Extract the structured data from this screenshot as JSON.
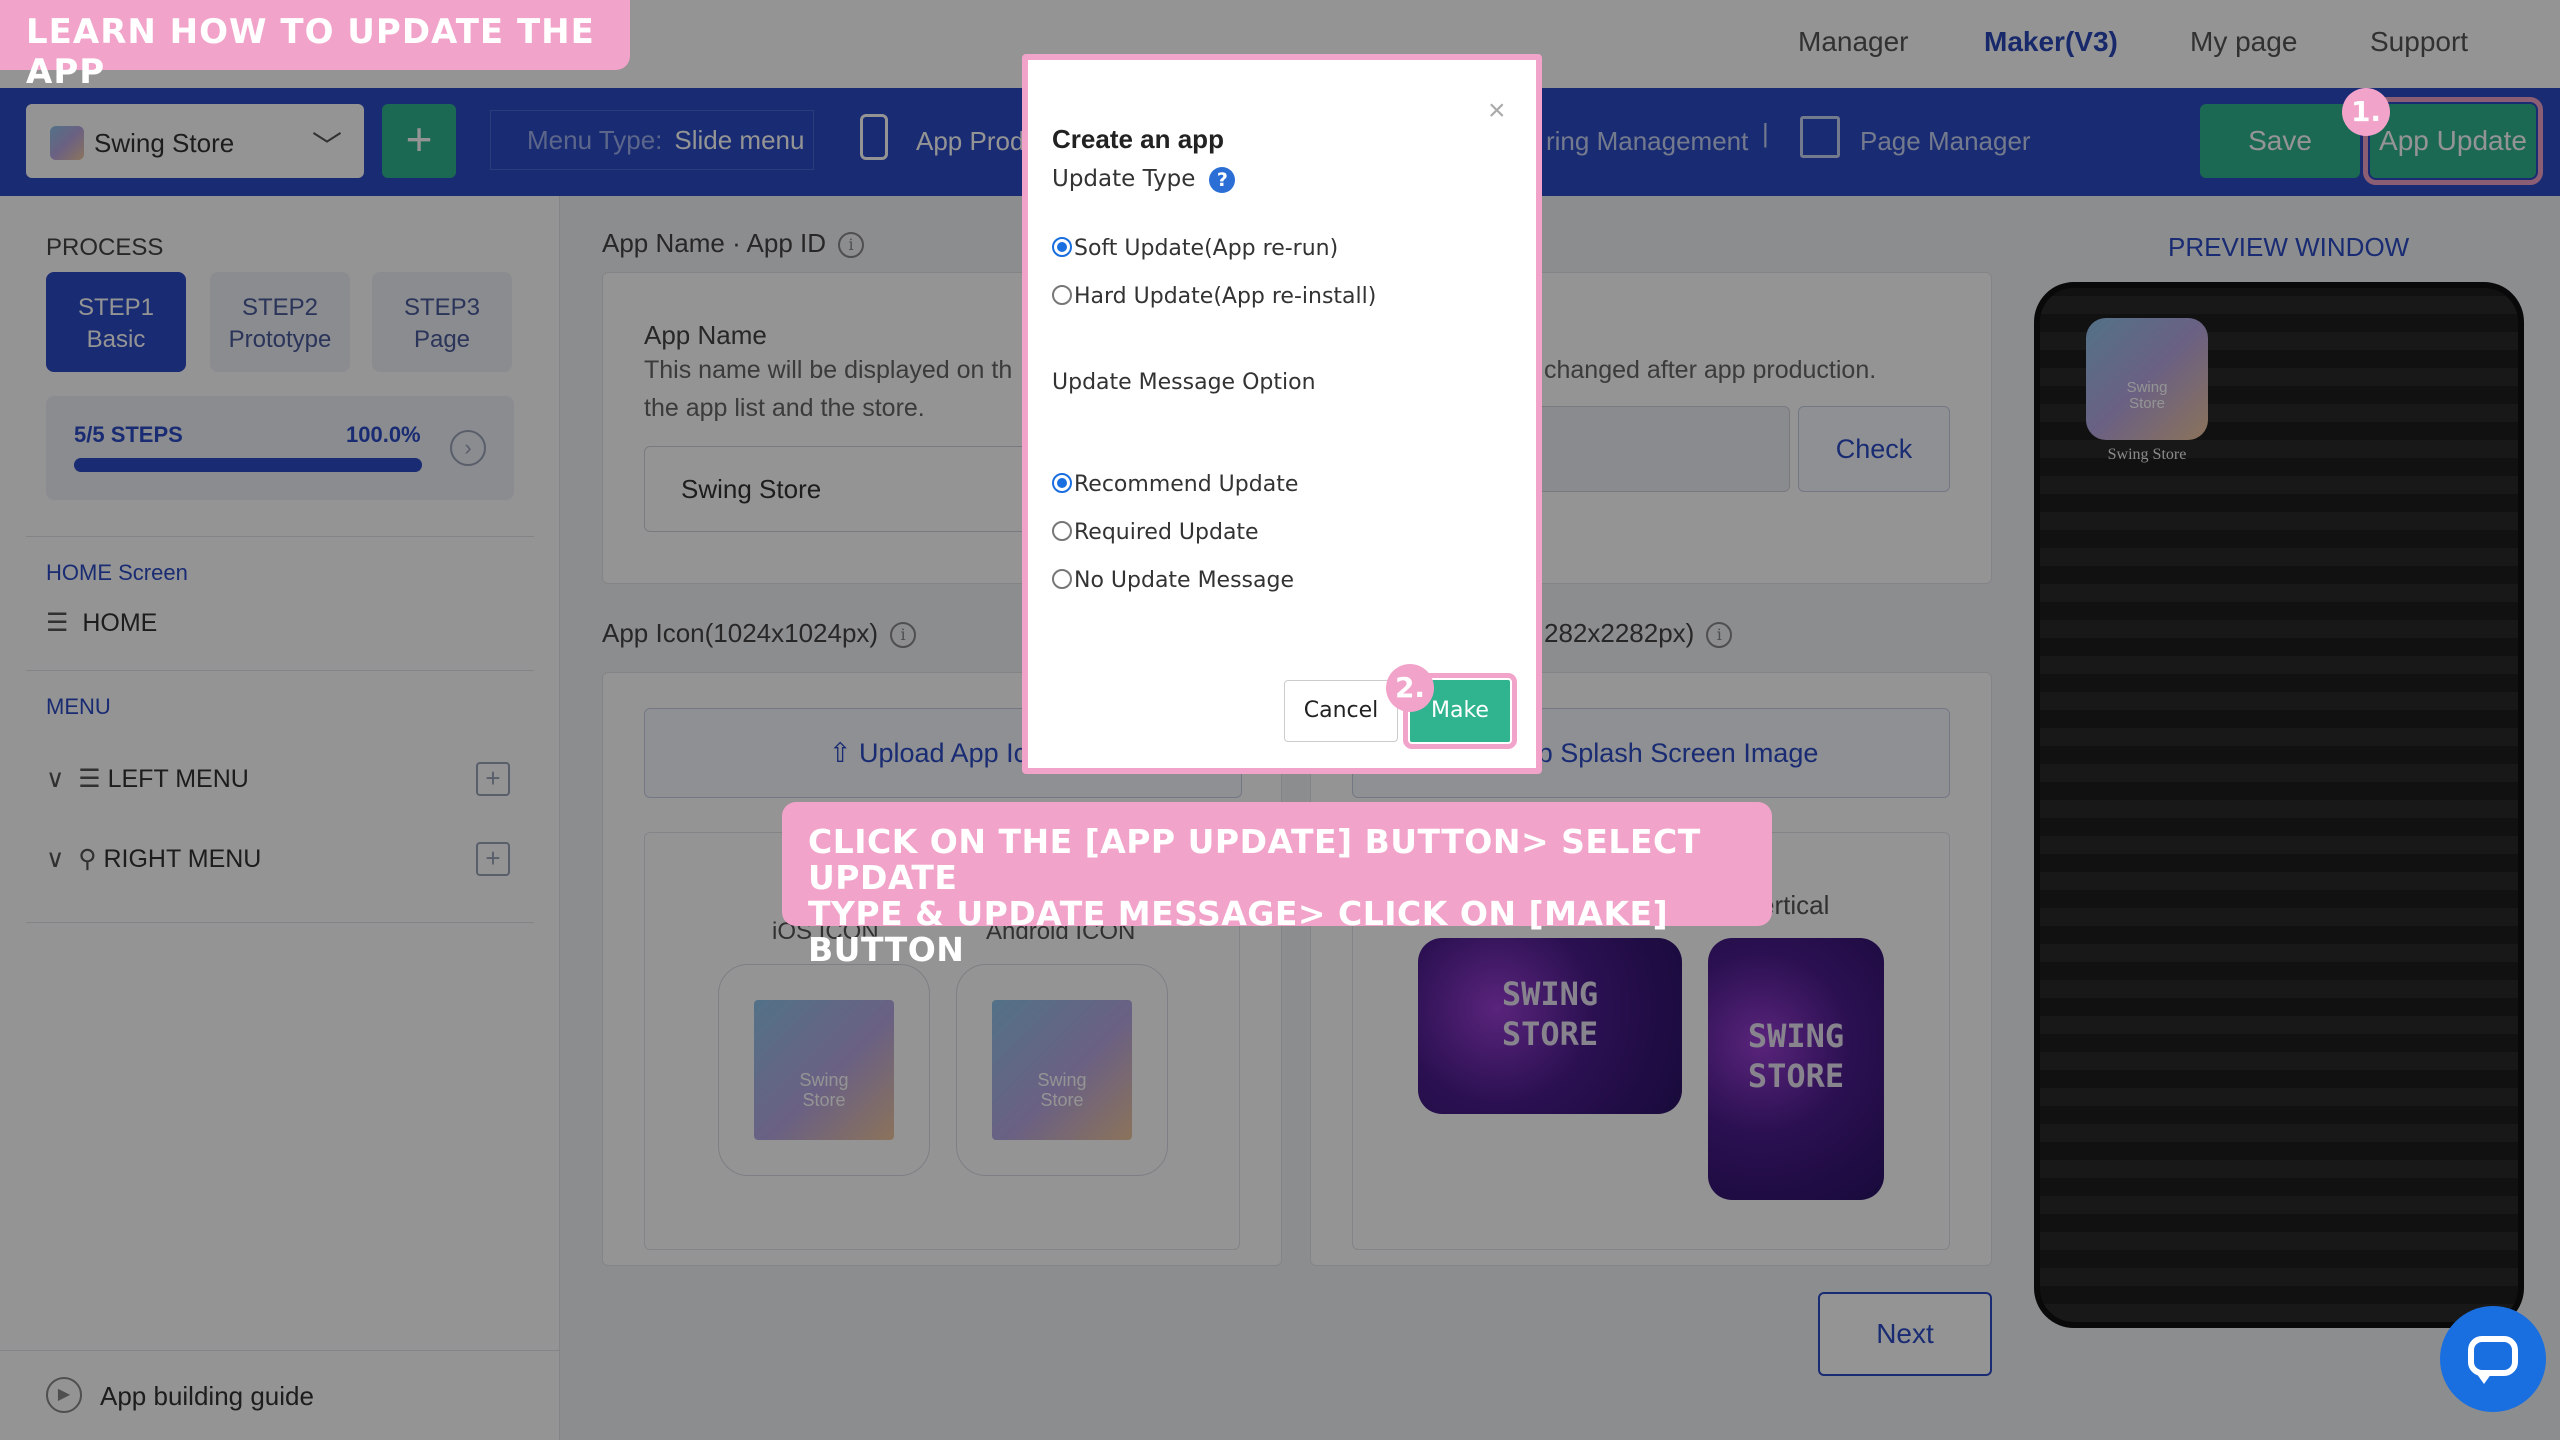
{
  "banner": {
    "text": "LEARN HOW TO UPDATE THE APP"
  },
  "topnav": {
    "manager": "Manager",
    "maker": "Maker(V3)",
    "mypage": "My page",
    "support": "Support"
  },
  "toolbar": {
    "store_name": "Swing Store",
    "menu_type_key": "Menu Type:",
    "menu_type_value": "Slide menu",
    "app_prod": "App Prod",
    "ring_management": "ring Management",
    "page_manager": "Page Manager",
    "save": "Save",
    "app_update": "App Update"
  },
  "sidebar": {
    "process": "PROCESS",
    "steps": [
      {
        "num": "STEP1",
        "name": "Basic"
      },
      {
        "num": "STEP2",
        "name": "Prototype"
      },
      {
        "num": "STEP3",
        "name": "Page"
      }
    ],
    "progress_label": "5/5 STEPS",
    "progress_pct": "100.0%",
    "progress_value": 1.0,
    "home_screen": "HOME Screen",
    "home": "HOME",
    "menu": "MENU",
    "left_menu": "LEFT MENU",
    "right_menu": "RIGHT MENU",
    "guide": "App building guide"
  },
  "main": {
    "app_name_section": "App Name · App ID",
    "app_name_label": "App Name",
    "app_name_desc1": "This name will be displayed on th",
    "app_name_desc2": "the app list and the store.",
    "app_name_value": "Swing Store",
    "changed_text": "changed after app production.",
    "check": "Check",
    "app_icon_section": "App Icon(1024x1024px)",
    "splash_section_tail": "282x2282px)",
    "upload_icon": "Upload App Icon",
    "upload_splash": "d App Splash Screen Image",
    "ios_icon": "iOS ICON",
    "android_icon": "Android ICON",
    "tile_text1": "Swing",
    "tile_text2": "Store",
    "vertical": "ertical",
    "splash_text1": "SWING",
    "splash_text2": "STORE",
    "next": "Next"
  },
  "preview": {
    "title": "PREVIEW WINDOW",
    "icon_label": "Swing Store"
  },
  "modal": {
    "title": "Create an app",
    "update_type": "Update Type",
    "close": "×",
    "soft": "Soft Update(App re-run)",
    "hard": "Hard Update(App re-install)",
    "msg_option": "Update Message Option",
    "recommend": "Recommend Update",
    "required": "Required Update",
    "no_msg": "No Update Message",
    "cancel": "Cancel",
    "make": "Make"
  },
  "badges": {
    "one": "1.",
    "two": "2."
  },
  "callout": {
    "line1": "CLICK ON THE [APP UPDATE] BUTTON> SELECT UPDATE",
    "line2": "TYPE & UPDATE MESSAGE> CLICK ON [MAKE] BUTTON"
  },
  "colors": {
    "brand_blue": "#2b4bc5",
    "green": "#2fb48f",
    "pink": "#f2a3c9"
  }
}
